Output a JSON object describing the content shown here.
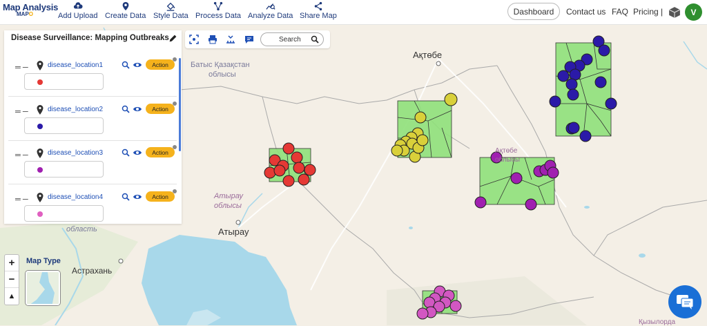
{
  "header": {
    "logo_title": "Map Analysis",
    "logo_sub_prefix": "MAP",
    "logo_sub_suffix": "O",
    "nav": [
      {
        "label": "Add Upload",
        "icon": "cloud-upload-icon"
      },
      {
        "label": "Create Data",
        "icon": "map-pin-icon"
      },
      {
        "label": "Style Data",
        "icon": "paint-bucket-icon"
      },
      {
        "label": "Process Data",
        "icon": "process-nodes-icon"
      },
      {
        "label": "Analyze Data",
        "icon": "analyze-chart-icon"
      },
      {
        "label": "Share Map",
        "icon": "share-icon"
      }
    ],
    "dashboard_label": "Dashboard",
    "contact_label": "Contact us",
    "faq_label": "FAQ",
    "pricing_label": "Pricing |",
    "avatar_initial": "V"
  },
  "panel": {
    "title": "Disease Surveillance: Mapping Outbreaks",
    "layers": [
      {
        "name": "disease_location1",
        "action_label": "Action",
        "color": "#e53935"
      },
      {
        "name": "disease_location2",
        "action_label": "Action",
        "color": "#2b1aa8"
      },
      {
        "name": "disease_location3",
        "action_label": "Action",
        "color": "#a020b0"
      },
      {
        "name": "disease_location4",
        "action_label": "Action",
        "color": "#e060c0"
      }
    ]
  },
  "toolbar": {
    "search_label": "Search"
  },
  "map": {
    "labels": {
      "aktobe_city": "Ақтөбе",
      "west_kz_1": "Батыс Қазақстан",
      "west_kz_2": "облысы",
      "aktobe_region_1": "Ақтөбе",
      "aktobe_region_2": "облысы",
      "atyrau_region_1": "Атырау",
      "atyrau_region_2": "облысы",
      "atyrau_city": "Атырау",
      "oblast": "область",
      "astrakhan": "Астрахань",
      "kyzylorda": "Қызылорда"
    },
    "maptype_label": "Map Type",
    "zoom_in": "+",
    "zoom_out": "−",
    "compass": "▲"
  },
  "colors": {
    "brand": "#1e3a7b",
    "accent": "#f5b21c",
    "polygon_fill": "#8fe07a",
    "water": "#a8d8ea",
    "land": "#f4efe6"
  }
}
